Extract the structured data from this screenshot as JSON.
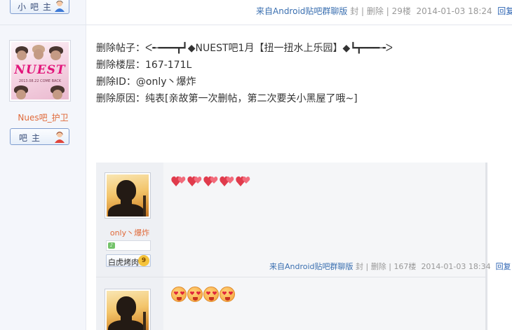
{
  "colors": {
    "accent_blue": "#2d64b3",
    "username_orange": "#e06a3a",
    "meta_gray": "#999999"
  },
  "top_post": {
    "role_badge_label": "小吧主",
    "meta": {
      "device": "来自Android贴吧群聊版",
      "actions": "封 | 删除 |",
      "floor": "29楼",
      "time": "2014-01-03 18:24",
      "reply": "回复"
    }
  },
  "author": {
    "avatar_caption_logo": "NUEST",
    "avatar_caption_sub": "2013.08.22 COME BACK",
    "name": "Nues吧_护卫",
    "role_badge_label": "吧主"
  },
  "post": {
    "lines": [
      "删除帖子：ᐸ╾━━━┳┛◆NUEST吧1月【扭一扭水上乐园】◆┗┳━━━╼ᐳ",
      "删除楼层：167-171L",
      "删除ID：@only丶爆炸",
      "删除原因：纯表[亲故第一次删帖，第二次要关小黑屋了哦~]"
    ]
  },
  "quoted_replies": [
    {
      "user_name": "only丶爆炸",
      "title_badge": "白虎烤肉",
      "level": "9",
      "emoji": [
        "heart-pair",
        "heart-pair",
        "heart-pair",
        "heart-pair",
        "heart-pair"
      ],
      "meta": {
        "device": "来自Android贴吧群聊版",
        "actions": "封 | 删除 |",
        "floor": "167楼",
        "time": "2014-01-03 18:34",
        "reply": "回复"
      }
    },
    {
      "emoji": [
        "kiss-face",
        "kiss-face",
        "kiss-face",
        "kiss-face"
      ]
    }
  ]
}
